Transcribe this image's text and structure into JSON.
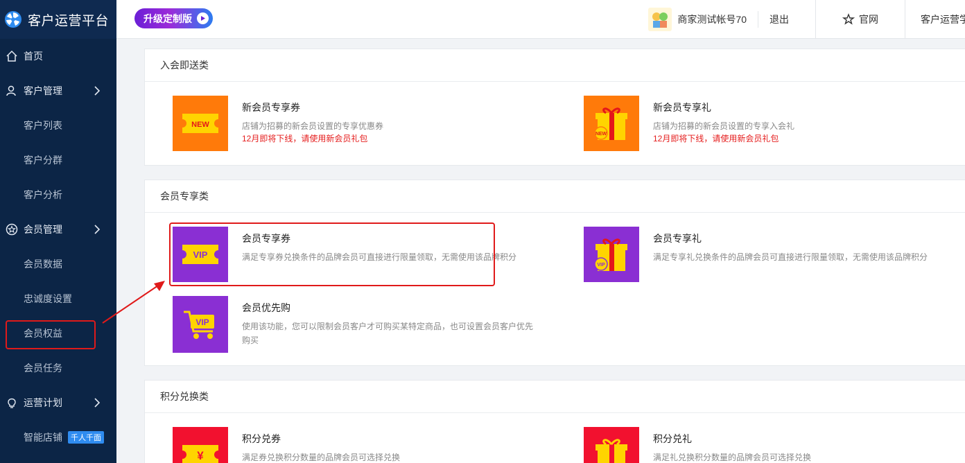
{
  "brand": {
    "title": "客户运营平台"
  },
  "header": {
    "upgrade_label": "升级定制版",
    "account_name": "商家测试帐号70",
    "logout_label": "退出",
    "site_label": "官网",
    "more_label": "客户运营学"
  },
  "sidebar": {
    "items": [
      {
        "label": "首页",
        "icon": "home-icon",
        "level": "top"
      },
      {
        "label": "客户管理",
        "icon": "customer-icon",
        "level": "top",
        "chevron": true
      },
      {
        "label": "客户列表",
        "level": "sub"
      },
      {
        "label": "客户分群",
        "level": "sub"
      },
      {
        "label": "客户分析",
        "level": "sub"
      },
      {
        "label": "会员管理",
        "icon": "member-icon",
        "level": "top",
        "chevron": true
      },
      {
        "label": "会员数据",
        "level": "sub"
      },
      {
        "label": "忠诚度设置",
        "level": "sub"
      },
      {
        "label": "会员权益",
        "level": "sub",
        "active": true
      },
      {
        "label": "会员任务",
        "level": "sub"
      },
      {
        "label": "运营计划",
        "icon": "bulb-icon",
        "level": "top",
        "chevron": true
      },
      {
        "label": "智能店铺",
        "level": "sub",
        "badge": "千人千面"
      }
    ]
  },
  "sections": [
    {
      "title": "入会即送类",
      "cards": [
        {
          "title": "新会员专享券",
          "desc": "店铺为招募的新会员设置的专享优惠券",
          "warn": "12月即将下线，请使用新会员礼包",
          "tile_text": "NEW"
        },
        {
          "title": "新会员专享礼",
          "desc": "店铺为招募的新会员设置的专享入会礼",
          "warn": "12月即将下线，请使用新会员礼包",
          "tile_text": "NEW"
        }
      ]
    },
    {
      "title": "会员专享类",
      "cards": [
        {
          "title": "会员专享券",
          "desc": "满足专享券兑换条件的品牌会员可直接进行限量领取，无需使用该品牌积分",
          "tile_text": "VIP"
        },
        {
          "title": "会员专享礼",
          "desc": "满足专享礼兑换条件的品牌会员可直接进行限量领取，无需使用该品牌积分",
          "tile_text": "VIP"
        },
        {
          "title": "会员优先购",
          "desc": "使用该功能，您可以限制会员客户才可购买某特定商品，也可设置会员客户优先购买",
          "tile_text": "VIP"
        }
      ]
    },
    {
      "title": "积分兑换类",
      "cards": [
        {
          "title": "积分兑券",
          "desc": "满足券兑换积分数量的品牌会员可选择兑换",
          "tile_text": "¥"
        },
        {
          "title": "积分兑礼",
          "desc": "满足礼兑换积分数量的品牌会员可选择兑换"
        }
      ]
    }
  ],
  "colors": {
    "sidebar_bg": "#0c2546",
    "orange": "#ff7a0a",
    "purple": "#8a2fd3",
    "red": "#f2112f",
    "highlight": "#e01a1a"
  }
}
